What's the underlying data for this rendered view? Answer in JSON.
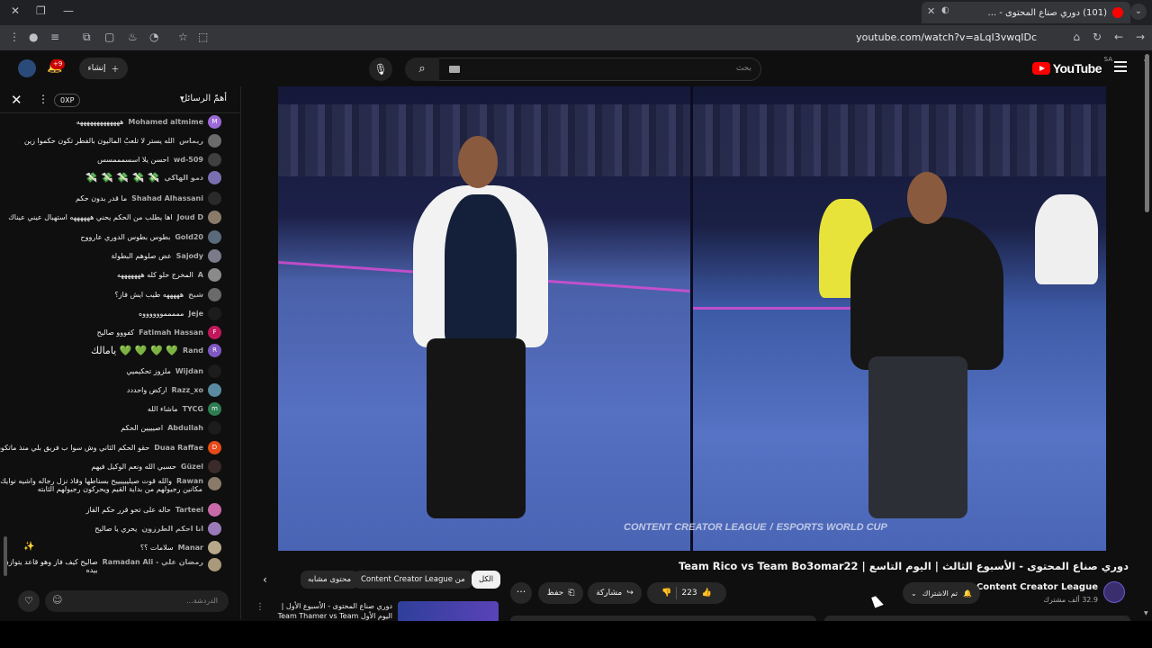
{
  "browser": {
    "tab_title": "(101) دوري صناع المحتوى - ...",
    "url": "youtube.com/watch?v=aLqI3vwqIDc"
  },
  "youtube": {
    "logo_text": "YouTube",
    "region": "SA",
    "search_placeholder": "بحث",
    "create_label": "إنشاء",
    "notifications_badge": "+9"
  },
  "chat": {
    "title": "أهمّ الرسائل",
    "xp_badge": "0XP",
    "input_placeholder": "الدردشة...",
    "messages": [
      {
        "author": "Mohamed altmime",
        "text": "هههههههههههههه",
        "avatar_letter": "M",
        "avatar_color": "#9c6ad6"
      },
      {
        "author": "ريماس",
        "text": "الله يستر لا تلعبٌ الماليون بالفطر تكون حكموا زين",
        "avatar_letter": "",
        "avatar_color": "#6b6b6b"
      },
      {
        "author": "wd-509",
        "text": "احسن يلا اسسمممسس",
        "avatar_letter": "",
        "avatar_color": "#404040"
      },
      {
        "author": "دمو الهاكي",
        "text": "💸 💸 💸 💸 💸",
        "avatar_letter": "",
        "avatar_color": "#7a6fb0"
      },
      {
        "author": "Shahad Alhassani",
        "text": "ما قدر بدون حكم",
        "avatar_letter": "",
        "avatar_color": "#2a2a2a"
      },
      {
        "author": "Joud D",
        "text": "اها يطلب من الحكم يحني ههههههه استهبال عيني عيناك",
        "avatar_letter": "",
        "avatar_color": "#8a7a6a"
      },
      {
        "author": "Gold20",
        "text": "بطوس بطوس الدوري عارووح",
        "avatar_letter": "",
        "avatar_color": "#5a6a7a"
      },
      {
        "author": "Sajody",
        "text": "عض صلوهم البطولة",
        "avatar_letter": "",
        "avatar_color": "#7a7a8a"
      },
      {
        "author": "A",
        "text": "المخرج حلو كله هههههههه",
        "avatar_letter": "",
        "avatar_color": "#8a8a8a"
      },
      {
        "author": "شيخ",
        "text": "هههههه طيب ايش فاز؟",
        "avatar_letter": "",
        "avatar_color": "#6a6a6a"
      },
      {
        "author": "Jeje",
        "text": "مممممووووووه",
        "avatar_letter": "",
        "avatar_color": "#1c1c1c"
      },
      {
        "author": "Fatimah Hassan",
        "text": "كفووو صاليح",
        "avatar_letter": "F",
        "avatar_color": "#c2185b"
      },
      {
        "author": "Rand",
        "text": "💚 💚 💚 💚 يامالك",
        "avatar_letter": "R",
        "avatar_color": "#7e57c2"
      },
      {
        "author": "Wijdan",
        "text": "ملزوز تحكيميي",
        "avatar_letter": "",
        "avatar_color": "#1c1c1c"
      },
      {
        "author": "Razz_xo",
        "text": "اركض واحددد",
        "avatar_letter": "",
        "avatar_color": "#5a8aa0"
      },
      {
        "author": "TYCG",
        "text": "ماشاء الله",
        "avatar_letter": "m",
        "avatar_color": "#2e7d52"
      },
      {
        "author": "Abdullah",
        "text": "اصيييين الحكم",
        "avatar_letter": "",
        "avatar_color": "#1c1c1c"
      },
      {
        "author": "Duaa Raffae",
        "text": "حقو الحكم الثاني وش سوا ب فريق بلي منذ ماتكون!!",
        "avatar_letter": "D",
        "avatar_color": "#e64a19"
      },
      {
        "author": "Güzel",
        "text": "حسبي الله ونعم الوكيل فيهم",
        "avatar_letter": "",
        "avatar_color": "#3a2a2a"
      },
      {
        "author": "Rawan",
        "text": "والله قوت صيلييييييح بسناطها وقاذ نزل رجاله واشيه نوايك",
        "text2": "مكانين رجيولهم من بداية القيم ويحركون رجيولهم الثابته",
        "avatar_letter": "",
        "avatar_color": "#8a7a6a"
      },
      {
        "author": "Tarteel",
        "text": "حاله على تحو قرر حكم الفاز",
        "avatar_letter": "",
        "avatar_color": "#c86aa8"
      },
      {
        "author": "انا احكم الطرزون",
        "text": "يحري يا صاليح",
        "avatar_letter": "",
        "avatar_color": "#9a7ab8"
      },
      {
        "author": "Manar",
        "text": "سلامات ؟؟",
        "avatar_letter": "",
        "avatar_color": "#b8a88a"
      },
      {
        "author": "Ramadan Ali - رمضان علي",
        "text": "صاليح كيف فاز وهو قاعد يتوازن",
        "text2": "بيده",
        "avatar_letter": "",
        "avatar_color": "#a89a7a"
      }
    ]
  },
  "video": {
    "watermark_left": "CONTENT CREATOR LEAGUE",
    "watermark_right": "ESPORTS WORLD CUP",
    "title": "دوري صناع المحتوى - الأسبوع الثالث | اليوم التاسع | Team Rico vs Team Bo3omar22",
    "channel_name": "Content Creator League",
    "subscribers": "32.9 ألف مشترك",
    "subscribe_label": "تم الاشتراك",
    "likes": "223",
    "share_label": "مشاركة",
    "save_label": "حفظ"
  },
  "chips": {
    "all": "الكل",
    "from_channel": "من Content Creator League",
    "related": "محتوى مشابه"
  },
  "recommendation": {
    "title": "دوري صناع المحتوى - الأسبوع الأول | اليوم الأول Team Thamer vs Team ..."
  },
  "colors": {
    "yt_red": "#ff0000",
    "page_bg": "#0f0f0f",
    "surface": "#272727"
  }
}
